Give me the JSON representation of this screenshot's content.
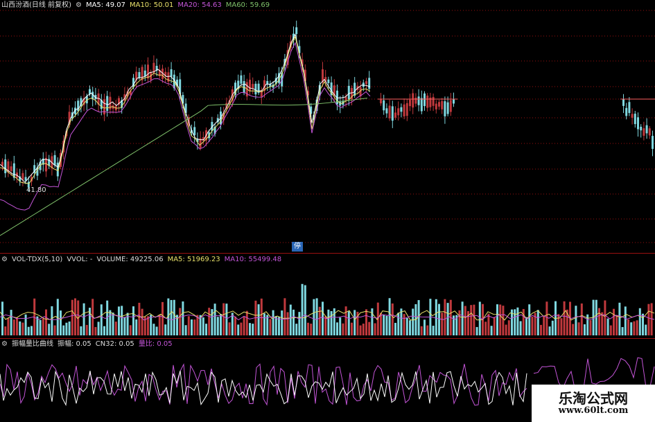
{
  "colors": {
    "up": "#c0393d",
    "down": "#7fd8e0",
    "ma5": "#ffffff",
    "ma10": "#e8e06a",
    "ma20": "#c455d8",
    "ma60": "#7fc16a",
    "grid": "#9b1010",
    "cn32": "#ffffff",
    "ratio": "#c455d8"
  },
  "price_panel": {
    "title": "山西汾酒(日线 前复权)",
    "ma5": "MA5: 49.07",
    "ma10": "MA10: 50.01",
    "ma20": "MA20: 54.63",
    "ma60": "MA60: 59.69",
    "low_label": "41.80",
    "stop_badge": "停",
    "gear_icon": "gear-icon"
  },
  "volume_panel": {
    "name": "VOL-TDX(5,10)",
    "vvol": "VVOL: -",
    "volume": "VOLUME: 49225.06",
    "ma5": "MA5: 51969.23",
    "ma10": "MA10: 55499.48"
  },
  "amp_panel": {
    "name": "振幅量比曲线",
    "amp": "振幅: 0.05",
    "cn32": "CN32: 0.05",
    "ratio": "量比: 0.05"
  },
  "watermark": {
    "title": "乐淘公式网",
    "url": "www.60lt.com"
  }
}
